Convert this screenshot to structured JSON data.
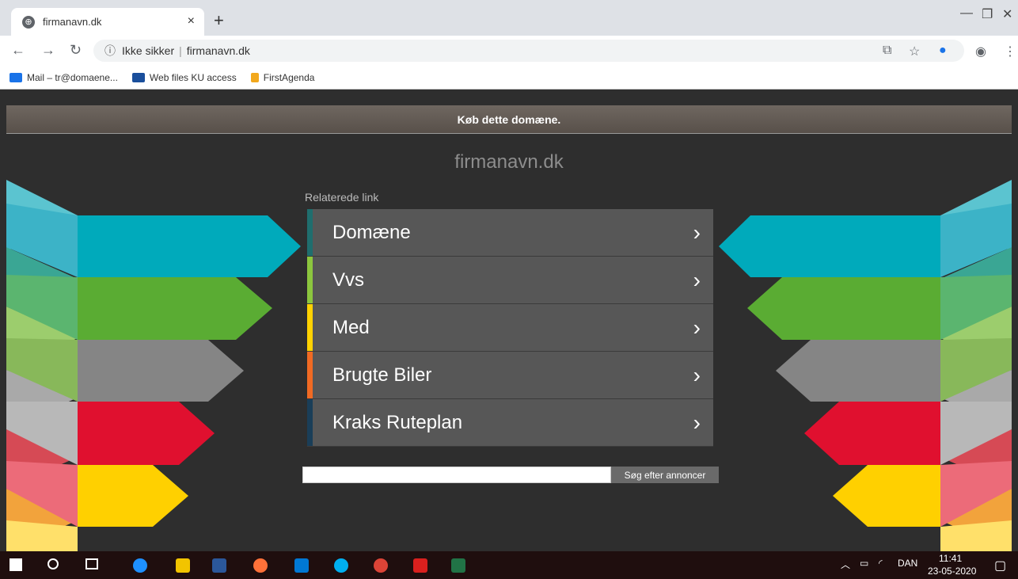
{
  "browser": {
    "tab_title": "firmanavn.dk",
    "tab_close": "×",
    "new_tab": "+",
    "security_label": "Ikke sikker",
    "url": "firmanavn.dk",
    "bookmarks": [
      {
        "label": "Mail – tr@domaene...",
        "color": "#1a73e8"
      },
      {
        "label": "Web files KU access",
        "color": "#1a4f9c"
      },
      {
        "label": "FirstAgenda",
        "color": "#f2a81d"
      }
    ]
  },
  "page": {
    "buy_banner": "Køb dette domæne.",
    "domain_title": "firmanavn.dk",
    "related_label": "Relaterede link",
    "links": [
      {
        "label": "Domæne",
        "color": "#1f6e6e"
      },
      {
        "label": "Vvs",
        "color": "#8cc63e"
      },
      {
        "label": "Med",
        "color": "#ffd200"
      },
      {
        "label": "Brugte Biler",
        "color": "#f16a23"
      },
      {
        "label": "Kraks Ruteplan",
        "color": "#1a3e58"
      }
    ],
    "chevron": "›",
    "search_button": "Søg efter annoncer",
    "search_value": ""
  },
  "taskbar": {
    "language": "DAN",
    "time": "11:41",
    "date": "23-05-2020"
  }
}
